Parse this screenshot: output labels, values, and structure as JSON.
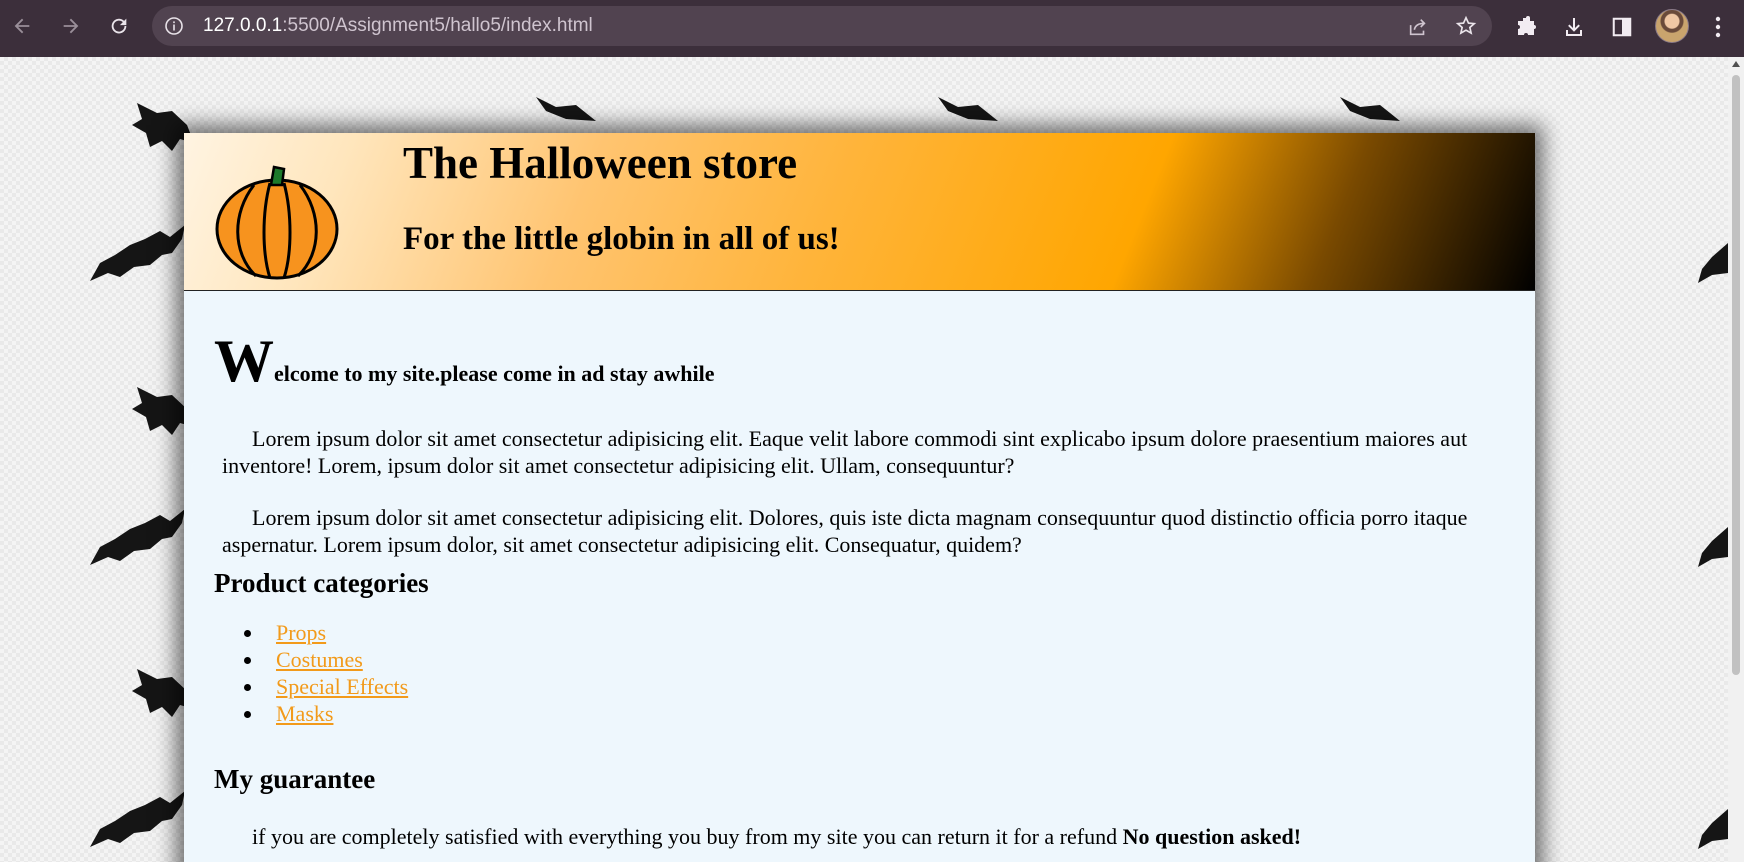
{
  "browser": {
    "url_host": "127.0.0.1",
    "url_path": ":5500/Assignment5/hallo5/index.html"
  },
  "site": {
    "title": "The Halloween store",
    "tagline": "For the little globin in all of us!"
  },
  "welcome": {
    "dropcap": "W",
    "rest": "elcome to my site.please come in ad stay awhile"
  },
  "paragraphs": [
    "Lorem ipsum dolor sit amet consectetur adipisicing elit. Eaque velit labore commodi sint explicabo ipsum dolore praesentium maiores aut inventore! Lorem, ipsum dolor sit amet consectetur adipisicing elit. Ullam, consequuntur?",
    "Lorem ipsum dolor sit amet consectetur adipisicing elit. Dolores, quis iste dicta magnam consequuntur quod distinctio officia porro itaque aspernatur. Lorem ipsum dolor, sit amet consectetur adipisicing elit. Consequatur, quidem?"
  ],
  "categories": {
    "heading": "Product categories",
    "items": [
      "Props",
      "Costumes",
      "Special Effects",
      "Masks"
    ]
  },
  "guarantee": {
    "heading": "My guarantee",
    "text": "if you are completely satisfied with everything you buy from my site you can return it for a refund ",
    "emphasis": "No question asked!"
  },
  "colors": {
    "link": "#f29a1a",
    "content_bg": "#eef7fd",
    "chrome_bg": "#3c2f3b"
  }
}
